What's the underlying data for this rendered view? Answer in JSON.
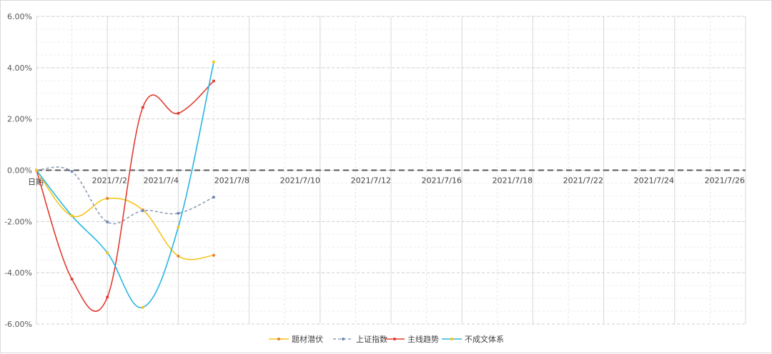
{
  "chart_data": {
    "type": "line",
    "xlabel": "日期",
    "ylabel": "",
    "ylim": [
      -0.06,
      0.06
    ],
    "ytick_labels": [
      "6.00%",
      "4.00%",
      "2.00%",
      "0.00%",
      "-2.00%",
      "-4.00%",
      "-6.00%"
    ],
    "ytick_values": [
      0.06,
      0.04,
      0.02,
      0.0,
      -0.02,
      -0.04,
      -0.06
    ],
    "x_tick_labels": [
      "2021/7/2",
      "2021/7/4",
      "2021/7/8",
      "2021/7/10",
      "2021/7/12",
      "2021/7/16",
      "2021/7/18",
      "2021/7/22",
      "2021/7/24",
      "2021/7/26"
    ],
    "grid": true,
    "legend_position": "bottom",
    "series": [
      {
        "name": "题材潜伏",
        "color": "#f5c518",
        "marker_color": "#ed7d31",
        "dash": false,
        "values": [
          0.0,
          -0.0178,
          -0.011,
          -0.0155,
          -0.0335,
          -0.0332
        ]
      },
      {
        "name": "上证指数",
        "color": "#8e9bb5",
        "marker_color": "#6f8ab8",
        "dash": true,
        "values": [
          0.0,
          -0.0005,
          -0.0202,
          -0.0158,
          -0.0168,
          -0.0105
        ]
      },
      {
        "name": "主线趋势",
        "color": "#e03c31",
        "marker_color": "#e03c31",
        "dash": false,
        "values": [
          0.0,
          -0.0425,
          -0.0495,
          0.0245,
          0.0222,
          0.0348
        ]
      },
      {
        "name": "不成文体系",
        "color": "#29b6e0",
        "marker_color": "#f5c518",
        "dash": false,
        "values": [
          0.0,
          -0.0178,
          -0.0322,
          -0.0535,
          -0.0222,
          0.0422
        ]
      }
    ]
  }
}
